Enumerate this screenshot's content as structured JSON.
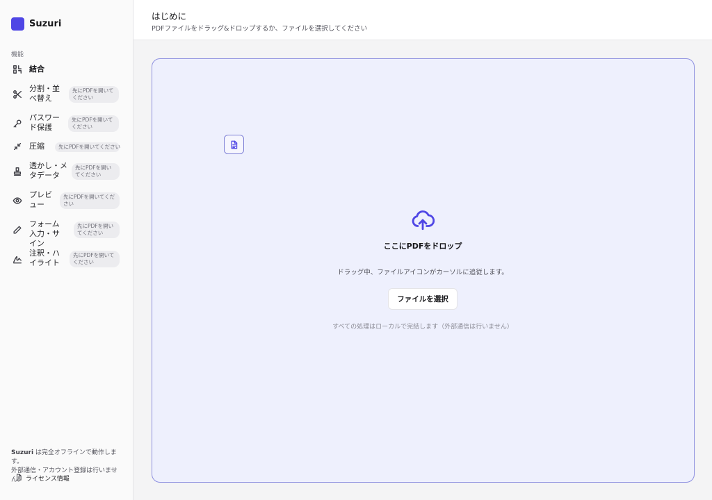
{
  "brand": {
    "name": "Suzuri",
    "accent": "#4f46e5"
  },
  "sidebar": {
    "section_label": "機能",
    "items": [
      {
        "label": "結合",
        "icon": "merge-icon",
        "badge": "",
        "active": true
      },
      {
        "label": "分割・並べ替え",
        "icon": "scissors-icon",
        "badge": "先にPDFを開いてください",
        "active": false
      },
      {
        "label": "パスワード保護",
        "icon": "key-icon",
        "badge": "先にPDFを開いてください",
        "active": false
      },
      {
        "label": "圧縮",
        "icon": "compress-icon",
        "badge": "先にPDFを開いてください",
        "active": false
      },
      {
        "label": "透かし・メタデータ",
        "icon": "stamp-icon",
        "badge": "先にPDFを開いてください",
        "active": false
      },
      {
        "label": "プレビュー",
        "icon": "eye-icon",
        "badge": "先にPDFを開いてください",
        "active": false
      },
      {
        "label": "フォーム入力・サイン",
        "icon": "pen-icon",
        "badge": "先にPDFを開いてください",
        "active": false
      },
      {
        "label": "注釈・ハイライト",
        "icon": "signature-icon",
        "badge": "先にPDFを開いてください",
        "active": false
      }
    ],
    "footer": {
      "brand": "Suzuri",
      "line1": " は完全オフラインで動作します。",
      "line2": "外部通信・アカウント登録は行いません。",
      "license_label": "ライセンス情報"
    }
  },
  "header": {
    "title": "はじめに",
    "subtitle": "PDFファイルをドラッグ&ドロップするか、ファイルを選択してください"
  },
  "dropzone": {
    "title": "ここにPDFをドロップ",
    "description": "ドラッグ中、ファイルアイコンがカーソルに追従します。",
    "select_button": "ファイルを選択",
    "note": "すべての処理はローカルで完結します（外部通信は行いません）"
  }
}
